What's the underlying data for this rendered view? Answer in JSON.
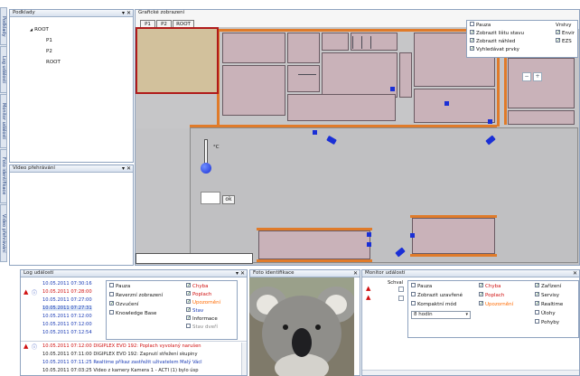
{
  "side_tabs": [
    {
      "label": "Podklady"
    },
    {
      "label": "Log událostí"
    },
    {
      "label": "Monitor událostí"
    },
    {
      "label": "Foto identifikace"
    },
    {
      "label": "Video přehrávání"
    }
  ],
  "podklady": {
    "title": "Podklady",
    "tree": [
      {
        "label": "ROOT",
        "expander": "◢"
      },
      {
        "label": "P1"
      },
      {
        "label": "P2"
      },
      {
        "label": "ROOT"
      }
    ]
  },
  "video_panel": {
    "title": "Video přehrávání"
  },
  "plan": {
    "title": "Grafické zobrazení",
    "tabs": [
      "P1",
      "P2",
      "ROOT"
    ],
    "overlay": {
      "left": [
        {
          "label": "Pauza",
          "checked": false
        },
        {
          "label": "Zobrazit lištu stavu",
          "checked": true
        },
        {
          "label": "Zobrazit náhled",
          "checked": true
        },
        {
          "label": "Vyhledávat prvky",
          "checked": true
        }
      ],
      "right_title": "Vrstvy",
      "right": [
        {
          "label": "Envir",
          "checked": true
        },
        {
          "label": "EZS",
          "checked": true
        }
      ]
    },
    "thermo_unit": "°C",
    "ok_label": "ok"
  },
  "log": {
    "title": "Log událostí",
    "times": [
      "10.05.2011 07:30:16",
      "10.05.2011 07:28:00",
      "10.05.2011 07:27:00",
      "10.05.2011 07:27:31",
      "10.05.2011 07:12:00",
      "10.05.2011 07:12:00",
      "10.05.2011 07:12:54"
    ],
    "popup_left": [
      {
        "label": "Pauza",
        "checked": false
      },
      {
        "label": "Reverzní zobrazení",
        "checked": false
      },
      {
        "label": "Ozvučení",
        "checked": true
      },
      {
        "label": "Knowledge Base",
        "checked": false
      }
    ],
    "popup_right": [
      {
        "label": "Chyba",
        "checked": true,
        "color": "red"
      },
      {
        "label": "Poplach",
        "checked": true,
        "color": "red"
      },
      {
        "label": "Upozornění",
        "checked": true,
        "color": "orange"
      },
      {
        "label": "Stav",
        "checked": true,
        "color": "blue"
      },
      {
        "label": "Informace",
        "checked": true,
        "color": "black"
      },
      {
        "label": "Stav dveří",
        "checked": false,
        "color": "gray"
      }
    ],
    "events": [
      {
        "time": "10.05.2011 07:12:00",
        "text": "DIGIPLEX EVO 192: Poplach vyvolaný narušen",
        "color": "red"
      },
      {
        "time": "10.05.2011 07:11:00",
        "text": "DIGIPLEX EVO 192: Zapnutí střežení skupiny",
        "color": "black"
      },
      {
        "time": "10.05.2011 07:11:25",
        "text": "Realtime příkaz zastřežit uživatelem Malý Václ",
        "color": "blue"
      },
      {
        "time": "10.05.2011 07:03:25",
        "text": "Video z kamery Kamera 1 - ACTI (1) bylo úsp",
        "color": "black"
      }
    ]
  },
  "foto": {
    "title": "Foto identifikace"
  },
  "monitor": {
    "title": "Monitor událostí",
    "col_header": "Schval",
    "left": [
      {
        "label": "Pauza",
        "checked": false
      },
      {
        "label": "Zobrazit uzavřené",
        "checked": false
      },
      {
        "label": "Kompaktní mód",
        "checked": false
      }
    ],
    "select_value": "8 hodin",
    "mid": [
      {
        "label": "Chyba",
        "checked": true,
        "color": "red"
      },
      {
        "label": "Poplach",
        "checked": true,
        "color": "red"
      },
      {
        "label": "Upozornění",
        "checked": true,
        "color": "orange"
      }
    ],
    "right": [
      {
        "label": "Zařízení",
        "checked": true
      },
      {
        "label": "Servisy",
        "checked": true
      },
      {
        "label": "Realtime",
        "checked": true
      },
      {
        "label": "Úlohy",
        "checked": false
      },
      {
        "label": "Pohyby",
        "checked": false
      }
    ]
  },
  "colors": {
    "accent": "#1a2fd6",
    "wall": "#e07b2a",
    "room": "#c9b2b9",
    "alarm": "#d01010"
  }
}
